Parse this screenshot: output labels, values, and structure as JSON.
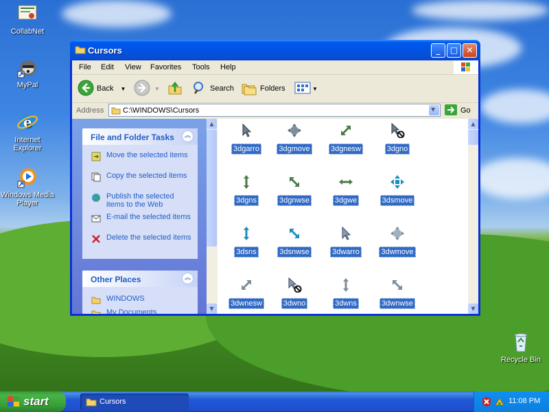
{
  "desktop": {
    "icons": [
      {
        "label": "CollabNet"
      },
      {
        "label": "MyPal"
      },
      {
        "label": "Internet Explorer"
      },
      {
        "label": "Windows Media Player"
      },
      {
        "label": "Recycle Bin"
      }
    ]
  },
  "window": {
    "title": "Cursors",
    "menu": [
      "File",
      "Edit",
      "View",
      "Favorites",
      "Tools",
      "Help"
    ],
    "toolbar": {
      "back": "Back",
      "search": "Search",
      "folders": "Folders"
    },
    "address": {
      "label": "Address",
      "value": "C:\\WINDOWS\\Cursors",
      "go": "Go"
    },
    "tasks_panel": {
      "title": "File and Folder Tasks",
      "items": [
        {
          "label": "Move the selected items",
          "icon": "move-icon"
        },
        {
          "label": "Copy the selected items",
          "icon": "copy-icon"
        },
        {
          "label": "Publish the selected items to the Web",
          "icon": "publish-icon"
        },
        {
          "label": "E-mail the selected items",
          "icon": "email-icon"
        },
        {
          "label": "Delete the selected items",
          "icon": "delete-icon"
        }
      ]
    },
    "places_panel": {
      "title": "Other Places",
      "items": [
        {
          "label": "WINDOWS"
        },
        {
          "label": "My Documents"
        }
      ]
    },
    "files": [
      {
        "name": "3dgarro"
      },
      {
        "name": "3dgmove"
      },
      {
        "name": "3dgnesw"
      },
      {
        "name": "3dgno"
      },
      {
        "name": "3dgns"
      },
      {
        "name": "3dgnwse"
      },
      {
        "name": "3dgwe"
      },
      {
        "name": "3dsmove"
      },
      {
        "name": "3dsns"
      },
      {
        "name": "3dsnwse"
      },
      {
        "name": "3dwarro"
      },
      {
        "name": "3dwmove"
      },
      {
        "name": "3dwnesw"
      },
      {
        "name": "3dwno"
      },
      {
        "name": "3dwns"
      },
      {
        "name": "3dwnwse"
      }
    ]
  },
  "taskbar": {
    "start": "start",
    "window_button": "Cursors",
    "clock": "11:08 PM"
  }
}
